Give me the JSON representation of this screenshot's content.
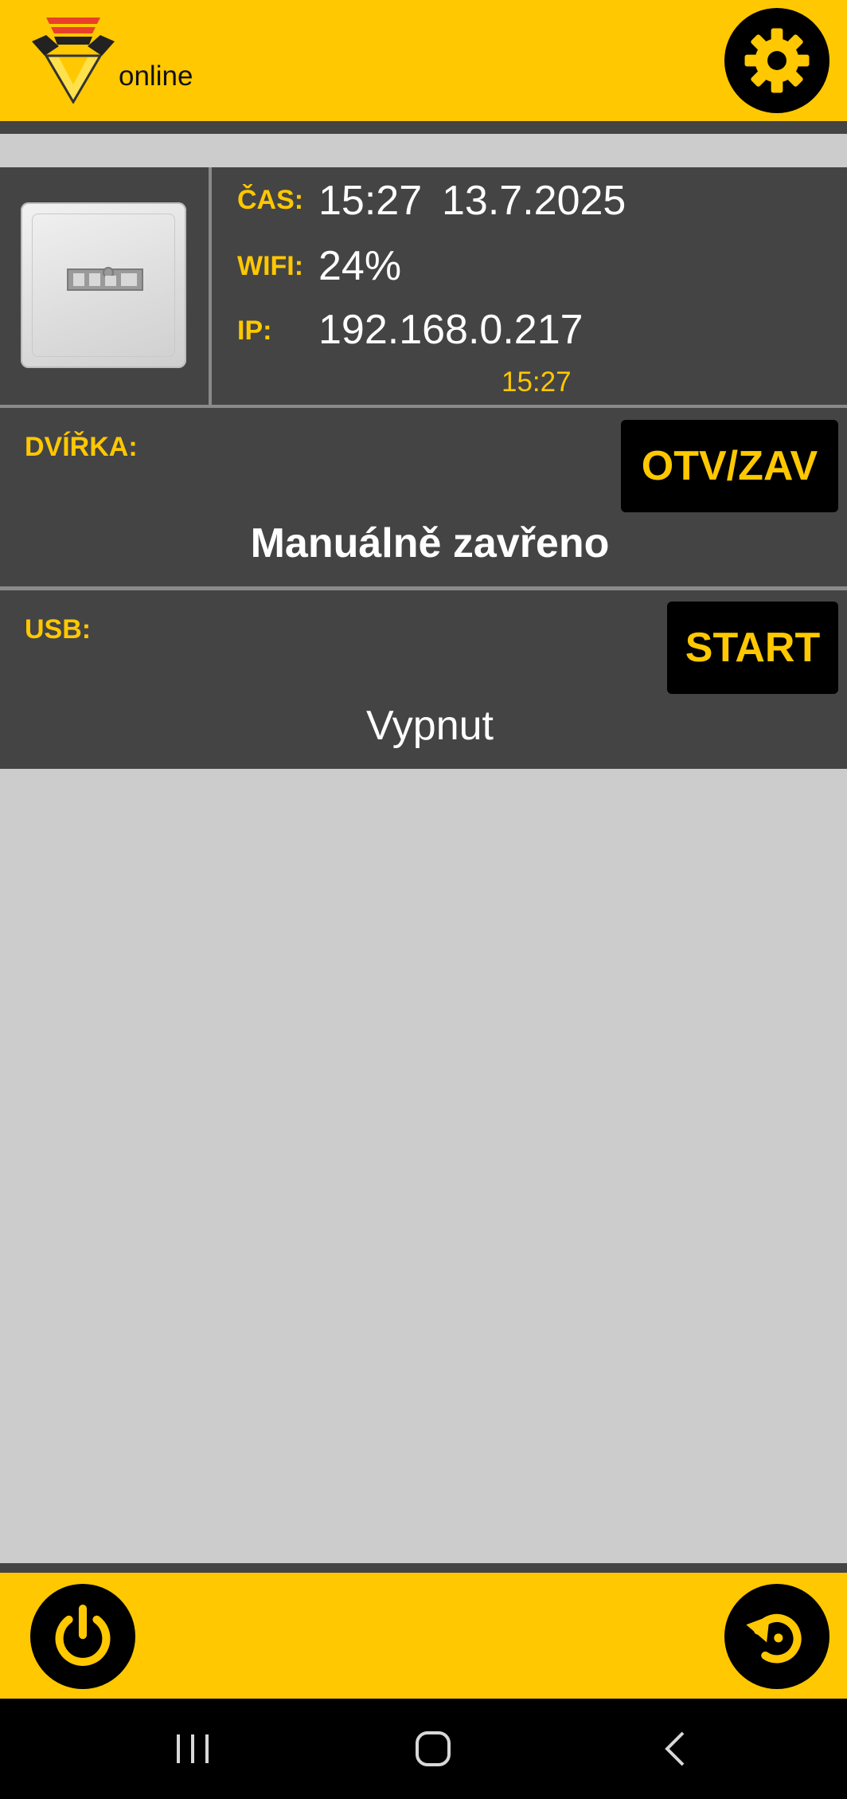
{
  "header": {
    "status": "online",
    "logo_icon": "triangle-logo-icon",
    "settings_icon": "gear-icon"
  },
  "info": {
    "time_label": "ČAS:",
    "time": "15:27",
    "date": "13.7.2025",
    "wifi_label": "WIFI:",
    "wifi": "24%",
    "ip_label": "IP:",
    "ip": "192.168.0.217",
    "updated": "15:27",
    "device_icon": "device-thumbnail"
  },
  "door": {
    "label": "DVÍŘKA:",
    "button": "OTV/ZAV",
    "state": "Manuálně zavřeno"
  },
  "usb": {
    "label": "USB:",
    "button": "START",
    "state": "Vypnut"
  },
  "footer": {
    "power_icon": "power-icon",
    "restart_icon": "restart-icon"
  },
  "colors": {
    "accent": "#ffc800",
    "panel": "#444444",
    "background": "#cccccc"
  }
}
